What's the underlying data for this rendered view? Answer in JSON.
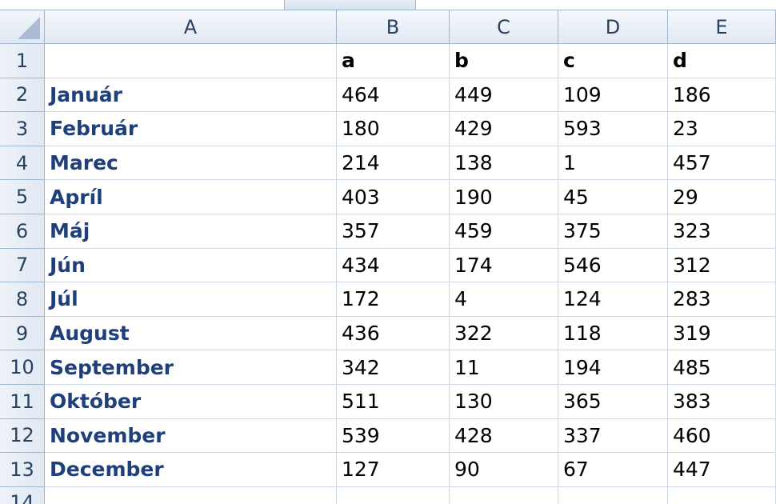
{
  "columns": [
    "A",
    "B",
    "C",
    "D",
    "E"
  ],
  "row_numbers": [
    "1",
    "2",
    "3",
    "4",
    "5",
    "6",
    "7",
    "8",
    "9",
    "10",
    "11",
    "12",
    "13",
    "14"
  ],
  "header_row": [
    "",
    "a",
    "b",
    "c",
    "d"
  ],
  "rows": [
    [
      "Január",
      "464",
      "449",
      "109",
      "186"
    ],
    [
      "Február",
      "180",
      "429",
      "593",
      "23"
    ],
    [
      "Marec",
      "214",
      "138",
      "1",
      "457"
    ],
    [
      "Apríl",
      "403",
      "190",
      "45",
      "29"
    ],
    [
      "Máj",
      "357",
      "459",
      "375",
      "323"
    ],
    [
      "Jún",
      "434",
      "174",
      "546",
      "312"
    ],
    [
      "Júl",
      "172",
      "4",
      "124",
      "283"
    ],
    [
      "August",
      "436",
      "322",
      "118",
      "319"
    ],
    [
      "September",
      "342",
      "11",
      "194",
      "485"
    ],
    [
      "Október",
      "511",
      "130",
      "365",
      "383"
    ],
    [
      "November",
      "539",
      "428",
      "337",
      "460"
    ],
    [
      "December",
      "127",
      "90",
      "67",
      "447"
    ]
  ]
}
